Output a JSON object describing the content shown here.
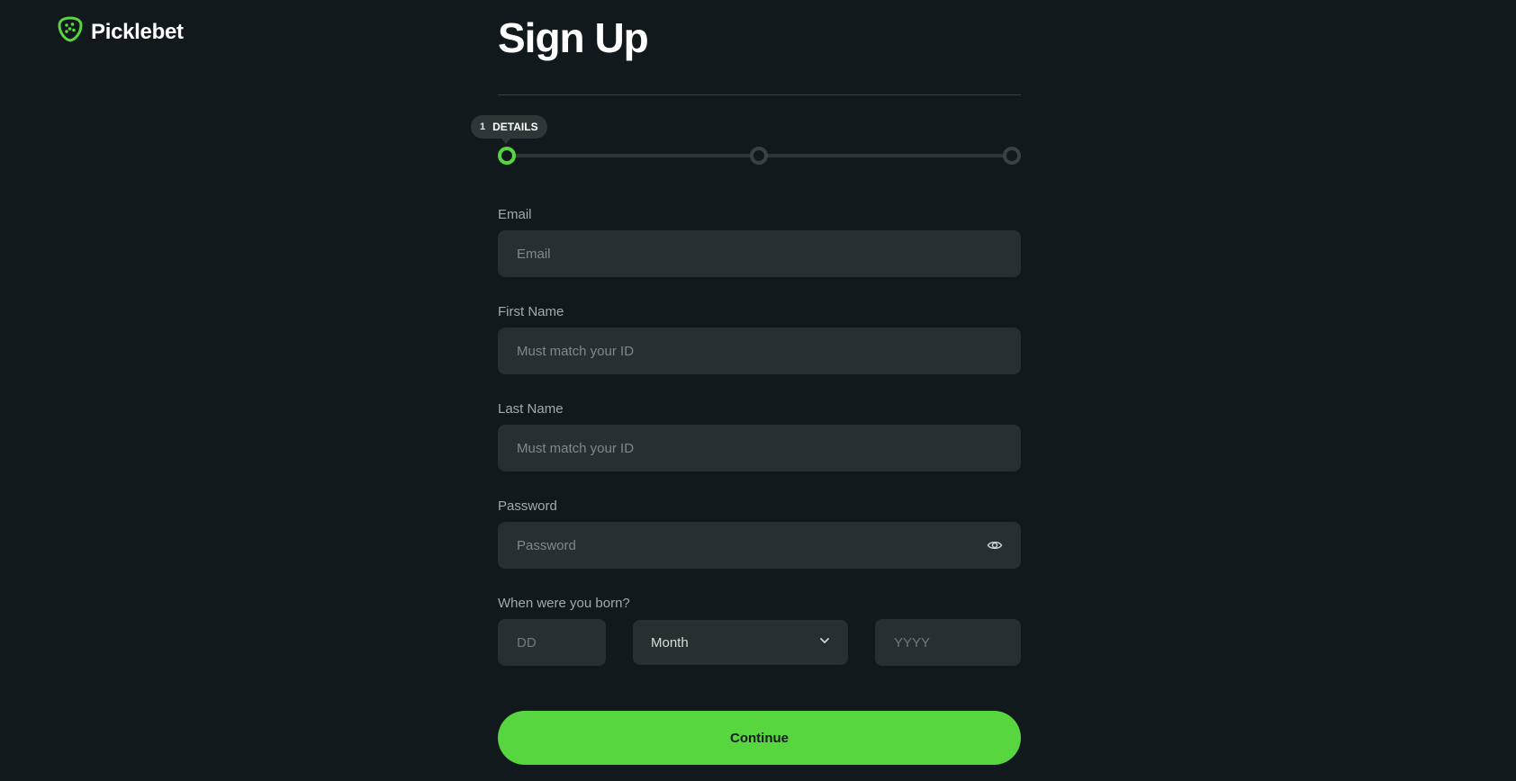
{
  "brand": {
    "name": "Picklebet",
    "logo_icon": "pickle-shield-icon",
    "accent_color": "#58d63f"
  },
  "page": {
    "title": "Sign Up"
  },
  "stepper": {
    "current_step": 1,
    "total_steps": 3,
    "tooltip_number": "1",
    "tooltip_label": "DETAILS"
  },
  "form": {
    "email": {
      "label": "Email",
      "placeholder": "Email",
      "value": ""
    },
    "first_name": {
      "label": "First Name",
      "placeholder": "Must match your ID",
      "value": ""
    },
    "last_name": {
      "label": "Last Name",
      "placeholder": "Must match your ID",
      "value": ""
    },
    "password": {
      "label": "Password",
      "placeholder": "Password",
      "value": "",
      "toggle_icon": "eye-icon"
    },
    "dob": {
      "label": "When were you born?",
      "day_placeholder": "DD",
      "month_value": "Month",
      "month_icon": "chevron-down-icon",
      "year_placeholder": "YYYY"
    },
    "submit_label": "Continue"
  }
}
